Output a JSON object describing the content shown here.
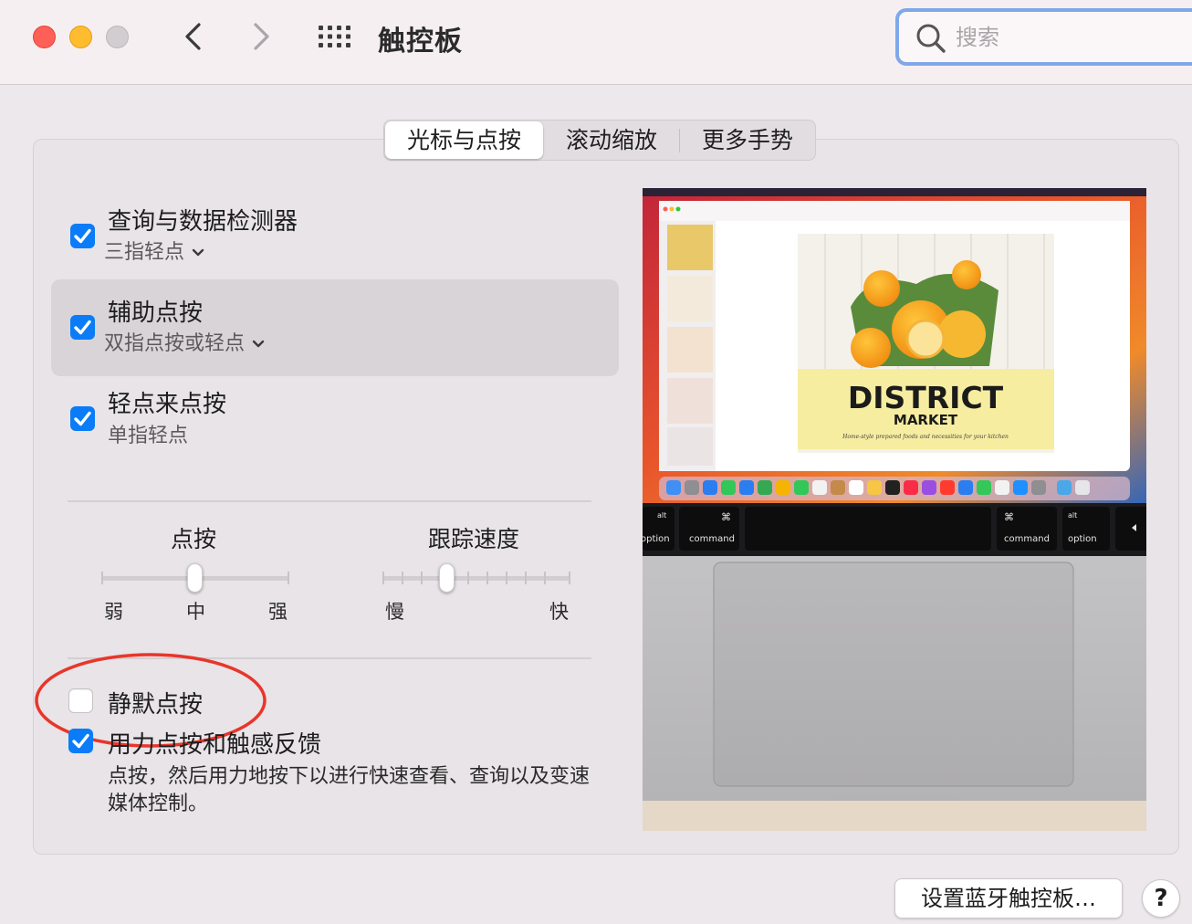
{
  "window": {
    "title": "触控板",
    "search_placeholder": "搜索"
  },
  "tabs": [
    {
      "label": "光标与点按",
      "active": true
    },
    {
      "label": "滚动缩放",
      "active": false
    },
    {
      "label": "更多手势",
      "active": false
    }
  ],
  "options": [
    {
      "title": "查询与数据检测器",
      "subtitle": "三指轻点",
      "checked": true,
      "has_menu": true
    },
    {
      "title": "辅助点按",
      "subtitle": "双指点按或轻点",
      "checked": true,
      "has_menu": true,
      "highlighted": true
    },
    {
      "title": "轻点来点按",
      "subtitle": "单指轻点",
      "checked": true,
      "has_menu": false
    }
  ],
  "sliders": {
    "click": {
      "label": "点按",
      "min_label": "弱",
      "mid_label": "中",
      "max_label": "强",
      "value": "中"
    },
    "tracking": {
      "label": "跟踪速度",
      "min_label": "慢",
      "max_label": "快",
      "value_fraction": 0.35
    }
  },
  "silent_click": {
    "title": "静默点按",
    "checked": false
  },
  "force_click": {
    "title": "用力点按和触感反馈",
    "checked": true,
    "description": "点按，然后用力地按下以进行快速查看、查询以及变速媒体控制。"
  },
  "preview": {
    "poster_title": "DISTRICT",
    "poster_subtitle": "MARKET",
    "poster_tagline": "Home-style prepared foods and necessities for your kitchen",
    "keys": [
      "alt",
      "option",
      "⌘",
      "command",
      "⌘",
      "command",
      "alt",
      "option"
    ]
  },
  "footer": {
    "bluetooth_button": "设置蓝牙触控板…",
    "help_button": "?"
  },
  "colors": {
    "accent": "#0a7cf8",
    "annotation": "#e8362b",
    "close": "#fe5f57",
    "minimize": "#febc2e"
  }
}
